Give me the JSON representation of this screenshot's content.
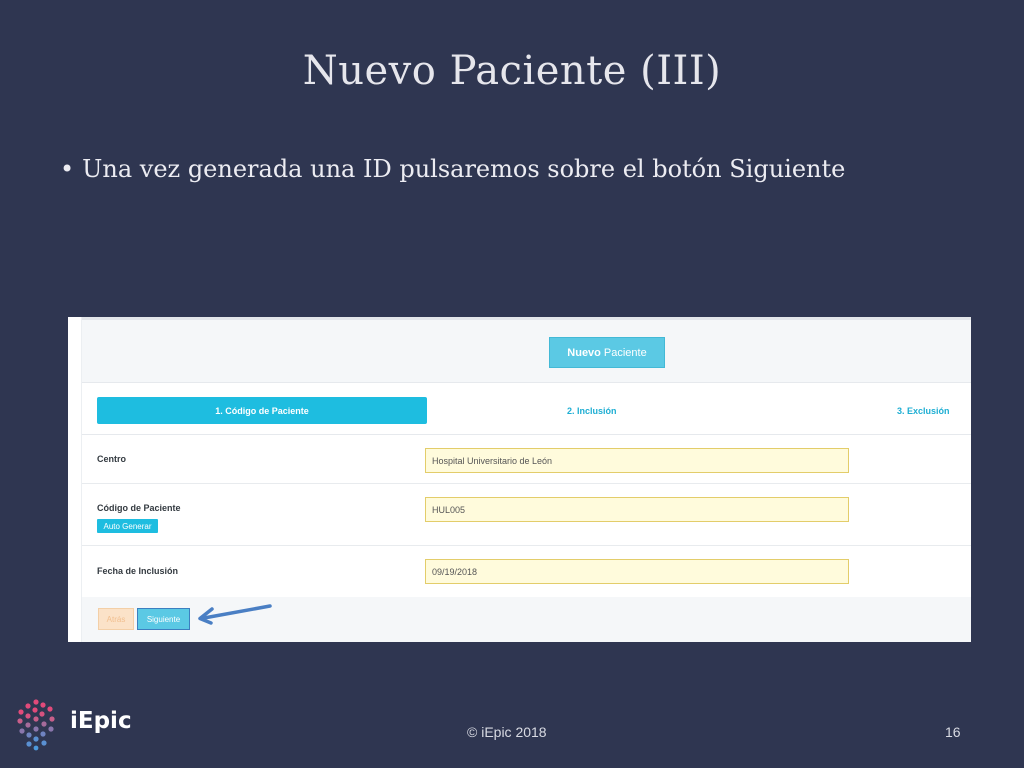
{
  "slide": {
    "title": "Nuevo Paciente (III)",
    "bullet": "Una vez generada una ID pulsaremos sobre el botón Siguiente",
    "bullet_marker": "•"
  },
  "app": {
    "header_button": {
      "bold": "Nuevo",
      "rest": "Paciente"
    },
    "steps": [
      {
        "label": "1. Código de Paciente",
        "active": true
      },
      {
        "label": "2. Inclusión",
        "active": false
      },
      {
        "label": "3. Exclusión",
        "active": false
      }
    ],
    "fields": {
      "centro": {
        "label": "Centro",
        "value": "Hospital Universitario de León"
      },
      "codigo": {
        "label": "Código de Paciente",
        "value": "HUL005",
        "auto_button": "Auto Generar"
      },
      "fecha": {
        "label": "Fecha de Inclusión",
        "value": "09/19/2018"
      }
    },
    "buttons": {
      "back": "Atrás",
      "next": "Siguiente"
    }
  },
  "footer": {
    "logo_text": "iEpic",
    "copyright": "© iEpic 2018",
    "page_number": "16"
  },
  "colors": {
    "background": "#2f3651",
    "accent": "#1ebde0",
    "field_bg": "#fffbdc",
    "arrow": "#4a7fc4"
  }
}
